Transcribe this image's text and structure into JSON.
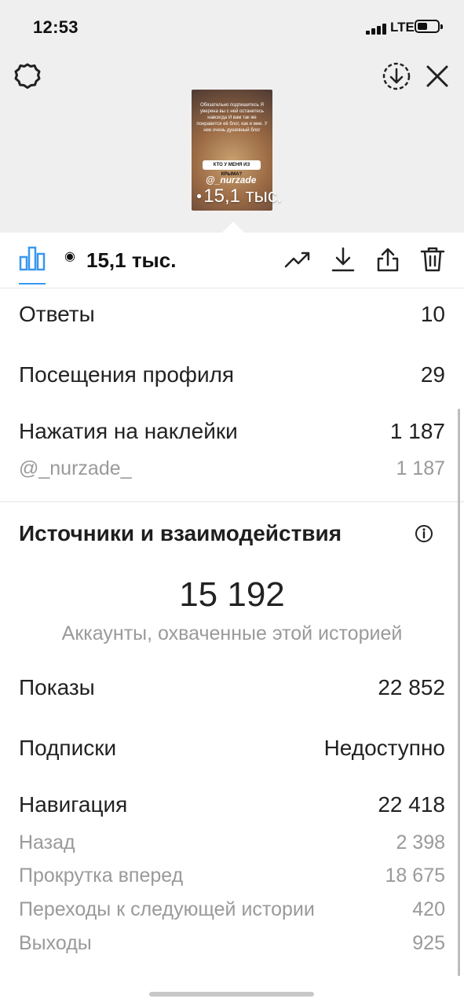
{
  "status": {
    "time": "12:53",
    "network": "LTE"
  },
  "story": {
    "caption": "Обязательно подпишитесь Я уверена вы с ней останетесь навсегда И вам так же понравится её блог, как и мне. У нее очень душевный блог",
    "chip": "КТО У МЕНЯ ИЗ КРЫМА?",
    "handle": "@_nurzade",
    "views": "15,1 тыс."
  },
  "toolbar": {
    "views": "15,1 тыс."
  },
  "metrics": {
    "replies": {
      "label": "Ответы",
      "value": "10"
    },
    "profile_visits": {
      "label": "Посещения профиля",
      "value": "29"
    },
    "sticker_taps": {
      "label": "Нажатия на наклейки",
      "value": "1 187"
    },
    "sticker_mention": {
      "label": "@_nurzade_",
      "value": "1 187"
    }
  },
  "discovery": {
    "title": "Источники и взаимодействия",
    "reach": "15 192",
    "reach_caption": "Аккаунты, охваченные этой историей",
    "impressions": {
      "label": "Показы",
      "value": "22 852"
    },
    "follows": {
      "label": "Подписки",
      "value": "Недоступно"
    },
    "navigation": {
      "label": "Навигация",
      "value": "22 418"
    },
    "back": {
      "label": "Назад",
      "value": "2 398"
    },
    "forward": {
      "label": "Прокрутка вперед",
      "value": "18 675"
    },
    "next_story": {
      "label": "Переходы к следующей истории",
      "value": "420"
    },
    "exits": {
      "label": "Выходы",
      "value": "925"
    }
  },
  "icons": {
    "settings": "gear-icon",
    "download_circle": "download-circle-icon",
    "close": "close-icon",
    "insights": "bar-chart-icon",
    "eye": "eye-icon",
    "promote": "trending-up-icon",
    "save": "download-icon",
    "share": "share-icon",
    "delete": "trash-icon",
    "info": "info-icon"
  },
  "colors": {
    "accent": "#3897f0",
    "top_background": "#efefef",
    "muted_text": "#9a9a9a"
  }
}
